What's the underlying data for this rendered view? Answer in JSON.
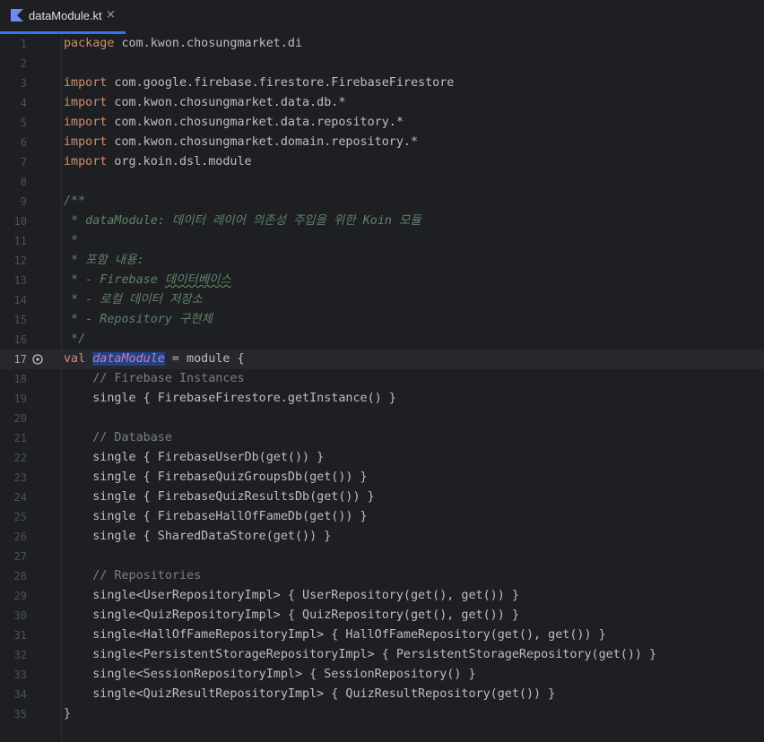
{
  "tab": {
    "label": "dataModule.kt",
    "close": "×",
    "icon": "kotlin-file-icon"
  },
  "gutter_icon": "run-gutter-icon",
  "current_line": 17,
  "lines": [
    {
      "n": "1",
      "spans": [
        {
          "t": "package",
          "c": "kw"
        },
        {
          "t": " com.kwon.chosungmarket.di"
        }
      ]
    },
    {
      "n": "2",
      "spans": []
    },
    {
      "n": "3",
      "spans": [
        {
          "t": "import",
          "c": "kw"
        },
        {
          "t": " com.google.firebase.firestore.FirebaseFirestore"
        }
      ]
    },
    {
      "n": "4",
      "spans": [
        {
          "t": "import",
          "c": "kw"
        },
        {
          "t": " com.kwon.chosungmarket.data.db.*"
        }
      ]
    },
    {
      "n": "5",
      "spans": [
        {
          "t": "import",
          "c": "kw"
        },
        {
          "t": " com.kwon.chosungmarket.data.repository.*"
        }
      ]
    },
    {
      "n": "6",
      "spans": [
        {
          "t": "import",
          "c": "kw"
        },
        {
          "t": " com.kwon.chosungmarket.domain.repository.*"
        }
      ]
    },
    {
      "n": "7",
      "spans": [
        {
          "t": "import",
          "c": "kw"
        },
        {
          "t": " org.koin.dsl.module"
        }
      ]
    },
    {
      "n": "8",
      "spans": []
    },
    {
      "n": "9",
      "spans": [
        {
          "t": "/**",
          "c": "doc"
        }
      ]
    },
    {
      "n": "10",
      "spans": [
        {
          "t": " * dataModule: 데이터 레이어 의존성 주입을 위한 Koin 모듈",
          "c": "doc"
        }
      ]
    },
    {
      "n": "11",
      "spans": [
        {
          "t": " *",
          "c": "doc"
        }
      ]
    },
    {
      "n": "12",
      "spans": [
        {
          "t": " * 포함 내용:",
          "c": "doc"
        }
      ]
    },
    {
      "n": "13",
      "spans": [
        {
          "t": " * - Firebase ",
          "c": "doc"
        },
        {
          "t": "데이터베이스",
          "c": "doc typo"
        }
      ]
    },
    {
      "n": "14",
      "spans": [
        {
          "t": " * - 로컬 데이터 저장소",
          "c": "doc"
        }
      ]
    },
    {
      "n": "15",
      "spans": [
        {
          "t": " * - Repository 구현체",
          "c": "doc"
        }
      ]
    },
    {
      "n": "16",
      "spans": [
        {
          "t": " */",
          "c": "doc"
        }
      ]
    },
    {
      "n": "17",
      "spans": [
        {
          "t": "val",
          "c": "kw"
        },
        {
          "t": " "
        },
        {
          "t": "dataModule",
          "c": "prop"
        },
        {
          "t": " = module {"
        }
      ]
    },
    {
      "n": "18",
      "spans": [
        {
          "t": "    "
        },
        {
          "t": "// Firebase Instances",
          "c": "cmt"
        }
      ]
    },
    {
      "n": "19",
      "spans": [
        {
          "t": "    single { FirebaseFirestore.getInstance() }"
        }
      ]
    },
    {
      "n": "20",
      "spans": []
    },
    {
      "n": "21",
      "spans": [
        {
          "t": "    "
        },
        {
          "t": "// Database",
          "c": "cmt"
        }
      ]
    },
    {
      "n": "22",
      "spans": [
        {
          "t": "    single { FirebaseUserDb(get()) }"
        }
      ]
    },
    {
      "n": "23",
      "spans": [
        {
          "t": "    single { FirebaseQuizGroupsDb(get()) }"
        }
      ]
    },
    {
      "n": "24",
      "spans": [
        {
          "t": "    single { FirebaseQuizResultsDb(get()) }"
        }
      ]
    },
    {
      "n": "25",
      "spans": [
        {
          "t": "    single { FirebaseHallOfFameDb(get()) }"
        }
      ]
    },
    {
      "n": "26",
      "spans": [
        {
          "t": "    single { SharedDataStore(get()) }"
        }
      ]
    },
    {
      "n": "27",
      "spans": []
    },
    {
      "n": "28",
      "spans": [
        {
          "t": "    "
        },
        {
          "t": "// Repositories",
          "c": "cmt"
        }
      ]
    },
    {
      "n": "29",
      "spans": [
        {
          "t": "    single<UserRepositoryImpl> { UserRepository(get(), get()) }"
        }
      ]
    },
    {
      "n": "30",
      "spans": [
        {
          "t": "    single<QuizRepositoryImpl> { QuizRepository(get(), get()) }"
        }
      ]
    },
    {
      "n": "31",
      "spans": [
        {
          "t": "    single<HallOfFameRepositoryImpl> { HallOfFameRepository(get(), get()) }"
        }
      ]
    },
    {
      "n": "32",
      "spans": [
        {
          "t": "    single<PersistentStorageRepositoryImpl> { PersistentStorageRepository(get()) }"
        }
      ]
    },
    {
      "n": "33",
      "spans": [
        {
          "t": "    single<SessionRepositoryImpl> { SessionRepository() }"
        }
      ]
    },
    {
      "n": "34",
      "spans": [
        {
          "t": "    single<QuizResultRepositoryImpl> { QuizResultRepository(get()) }"
        }
      ]
    },
    {
      "n": "35",
      "spans": [
        {
          "t": "}"
        }
      ]
    }
  ]
}
